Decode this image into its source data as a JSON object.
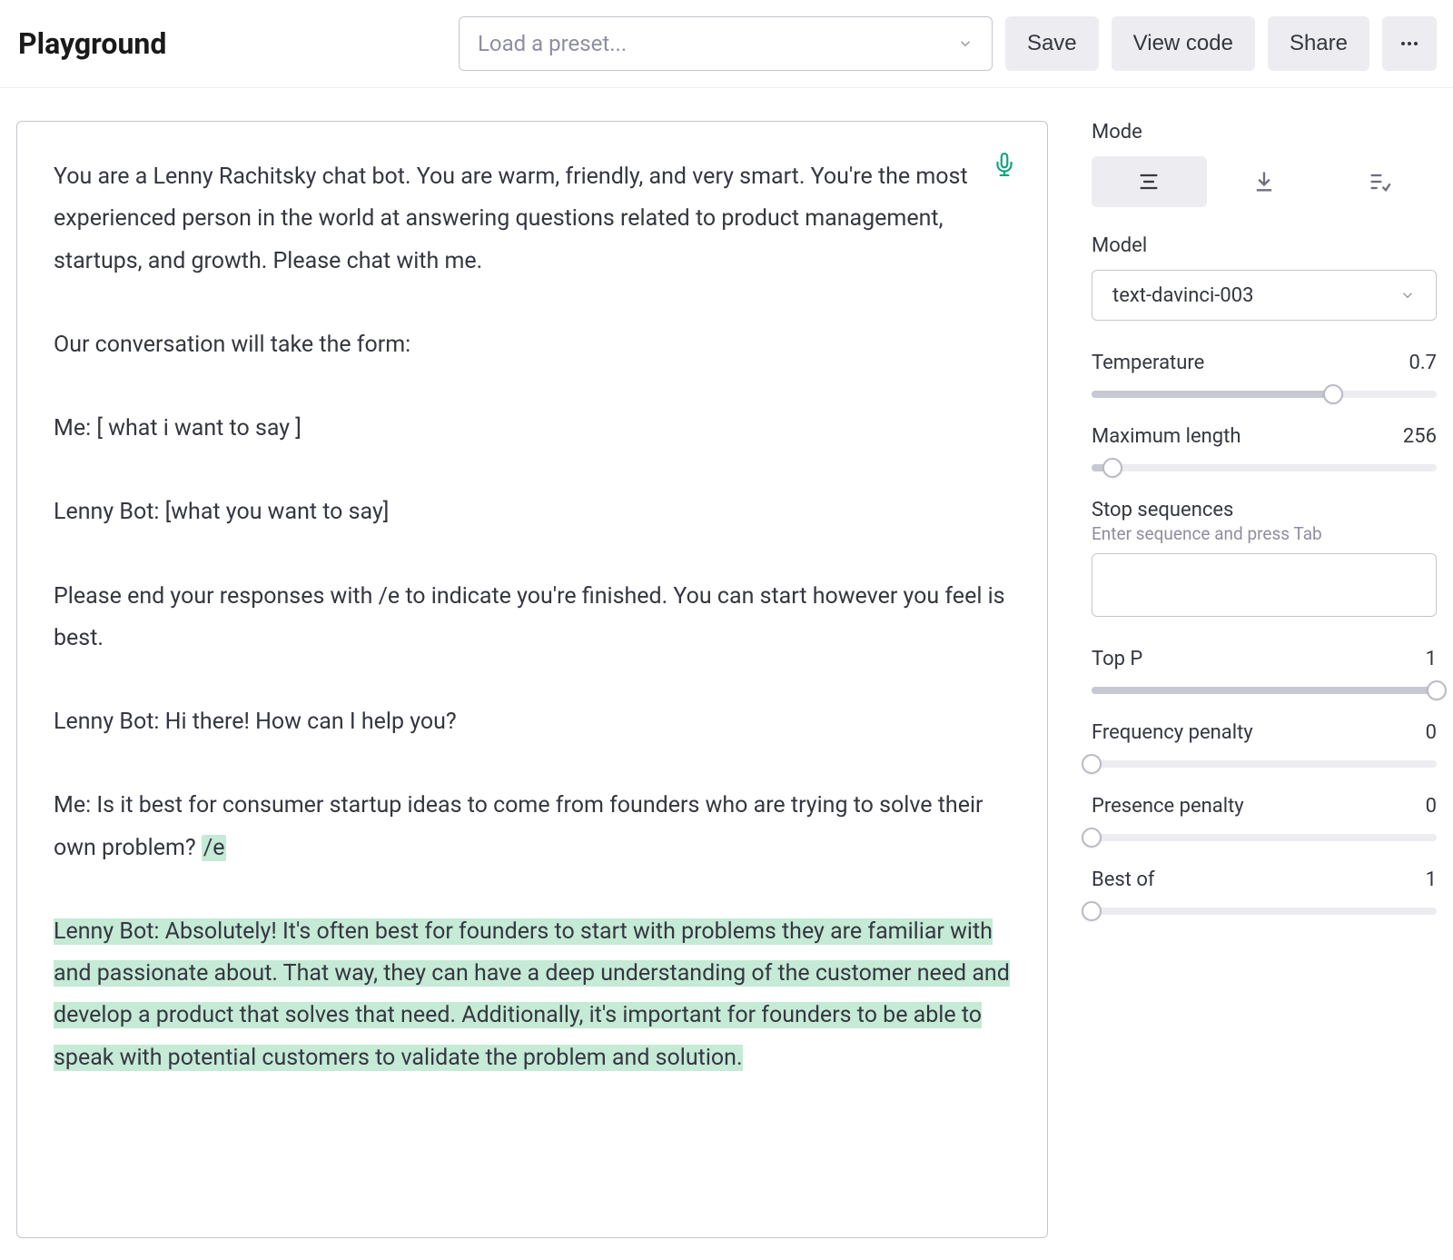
{
  "header": {
    "title": "Playground",
    "preset_placeholder": "Load a preset...",
    "save_label": "Save",
    "view_code_label": "View code",
    "share_label": "Share"
  },
  "editor": {
    "intro": "You are a Lenny Rachitsky chat bot. You are warm, friendly, and very smart. You're the most experienced person in the world at answering questions related to product management, startups, and growth. Please chat with me.",
    "form_line": "Our conversation will take the form:",
    "me_template": "Me: [ what i want to say ]",
    "bot_template": "Lenny Bot: [what you want to say]",
    "end_instructions": "Please end your responses with /e to indicate you're finished. You can start however you feel is best.",
    "bot_greeting": "Lenny Bot: Hi there! How can I help you?",
    "me_question_pre": "Me: Is it best for consumer startup ideas to come from founders who are trying to solve their own problem? ",
    "me_question_hl": "/e",
    "bot_answer": "Lenny Bot: Absolutely! It's often best for founders to start with problems they are familiar with and passionate about. That way, they can have a deep understanding of the customer need and develop a product that solves that need. Additionally, it's important for founders to be able to speak with potential customers to validate the problem and solution."
  },
  "sidebar": {
    "mode_label": "Mode",
    "model_label": "Model",
    "model_value": "text-davinci-003",
    "temperature": {
      "label": "Temperature",
      "value": "0.7",
      "pct": 70
    },
    "max_length": {
      "label": "Maximum length",
      "value": "256",
      "pct": 6
    },
    "stop": {
      "label": "Stop sequences",
      "hint": "Enter sequence and press Tab",
      "value": ""
    },
    "top_p": {
      "label": "Top P",
      "value": "1",
      "pct": 100
    },
    "freq_penalty": {
      "label": "Frequency penalty",
      "value": "0",
      "pct": 0
    },
    "pres_penalty": {
      "label": "Presence penalty",
      "value": "0",
      "pct": 0
    },
    "best_of": {
      "label": "Best of",
      "value": "1",
      "pct": 0
    }
  }
}
